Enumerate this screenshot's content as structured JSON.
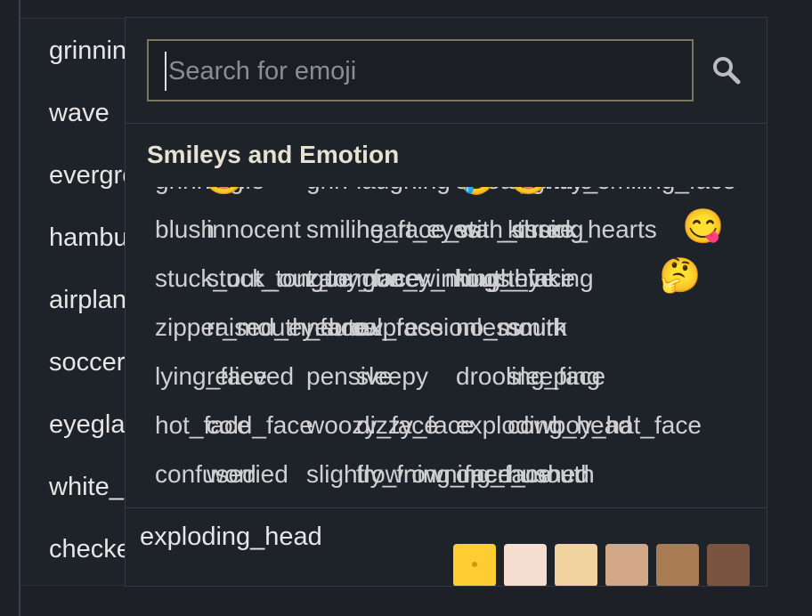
{
  "background_list": [
    "grinning",
    "wave",
    "evergreen_tree",
    "hamburger",
    "airplane",
    "soccer",
    "eyeglasses",
    "white_check_mark",
    "checkered_flag"
  ],
  "search": {
    "placeholder": "Search for emoji"
  },
  "category": {
    "title": "Smileys and Emotion"
  },
  "emoji_rows": [
    [
      "grinning",
      "smile",
      "grin",
      "laughing",
      "sweat_smile",
      "slightly_smiling_face"
    ],
    [
      "blush",
      "innocent",
      "smiling_face_with_three_hearts",
      "heart_eyes",
      "star_struck",
      "kissing"
    ],
    [
      "stuck_out_tongue",
      "stuck_out_tongue_winking_eye",
      "zany_face",
      "money_mouth_face",
      "hugs",
      "thinking"
    ],
    [
      "zipper_mouth_face",
      "raised_eyebrow",
      "neutral_face",
      "expressionless",
      "no_mouth",
      "smirk"
    ],
    [
      "lying_face",
      "relieved",
      "pensive",
      "sleepy",
      "drooling_face",
      "sleeping"
    ],
    [
      "hot_face",
      "cold_face",
      "woozy_face",
      "dizzy_face",
      "exploding_head",
      "cowboy_hat_face"
    ],
    [
      "confused",
      "worried",
      "slightly_frowning_face",
      "frowning_face",
      "open_mouth",
      "hushed"
    ]
  ],
  "rendered_emojis": [
    {
      "row": 0,
      "glyph": "😃"
    },
    {
      "row": 0,
      "glyph": "🤣"
    },
    {
      "row": 0,
      "glyph": "😂"
    },
    {
      "row": 1,
      "glyph": "😋"
    },
    {
      "row": 2,
      "glyph": "🤔"
    }
  ],
  "preview": {
    "name": "exploding_head"
  },
  "skin_tones": [
    "#ffcc33",
    "#f5ddd0",
    "#f0d39e",
    "#d1a787",
    "#a97c53",
    "#7a5440"
  ]
}
